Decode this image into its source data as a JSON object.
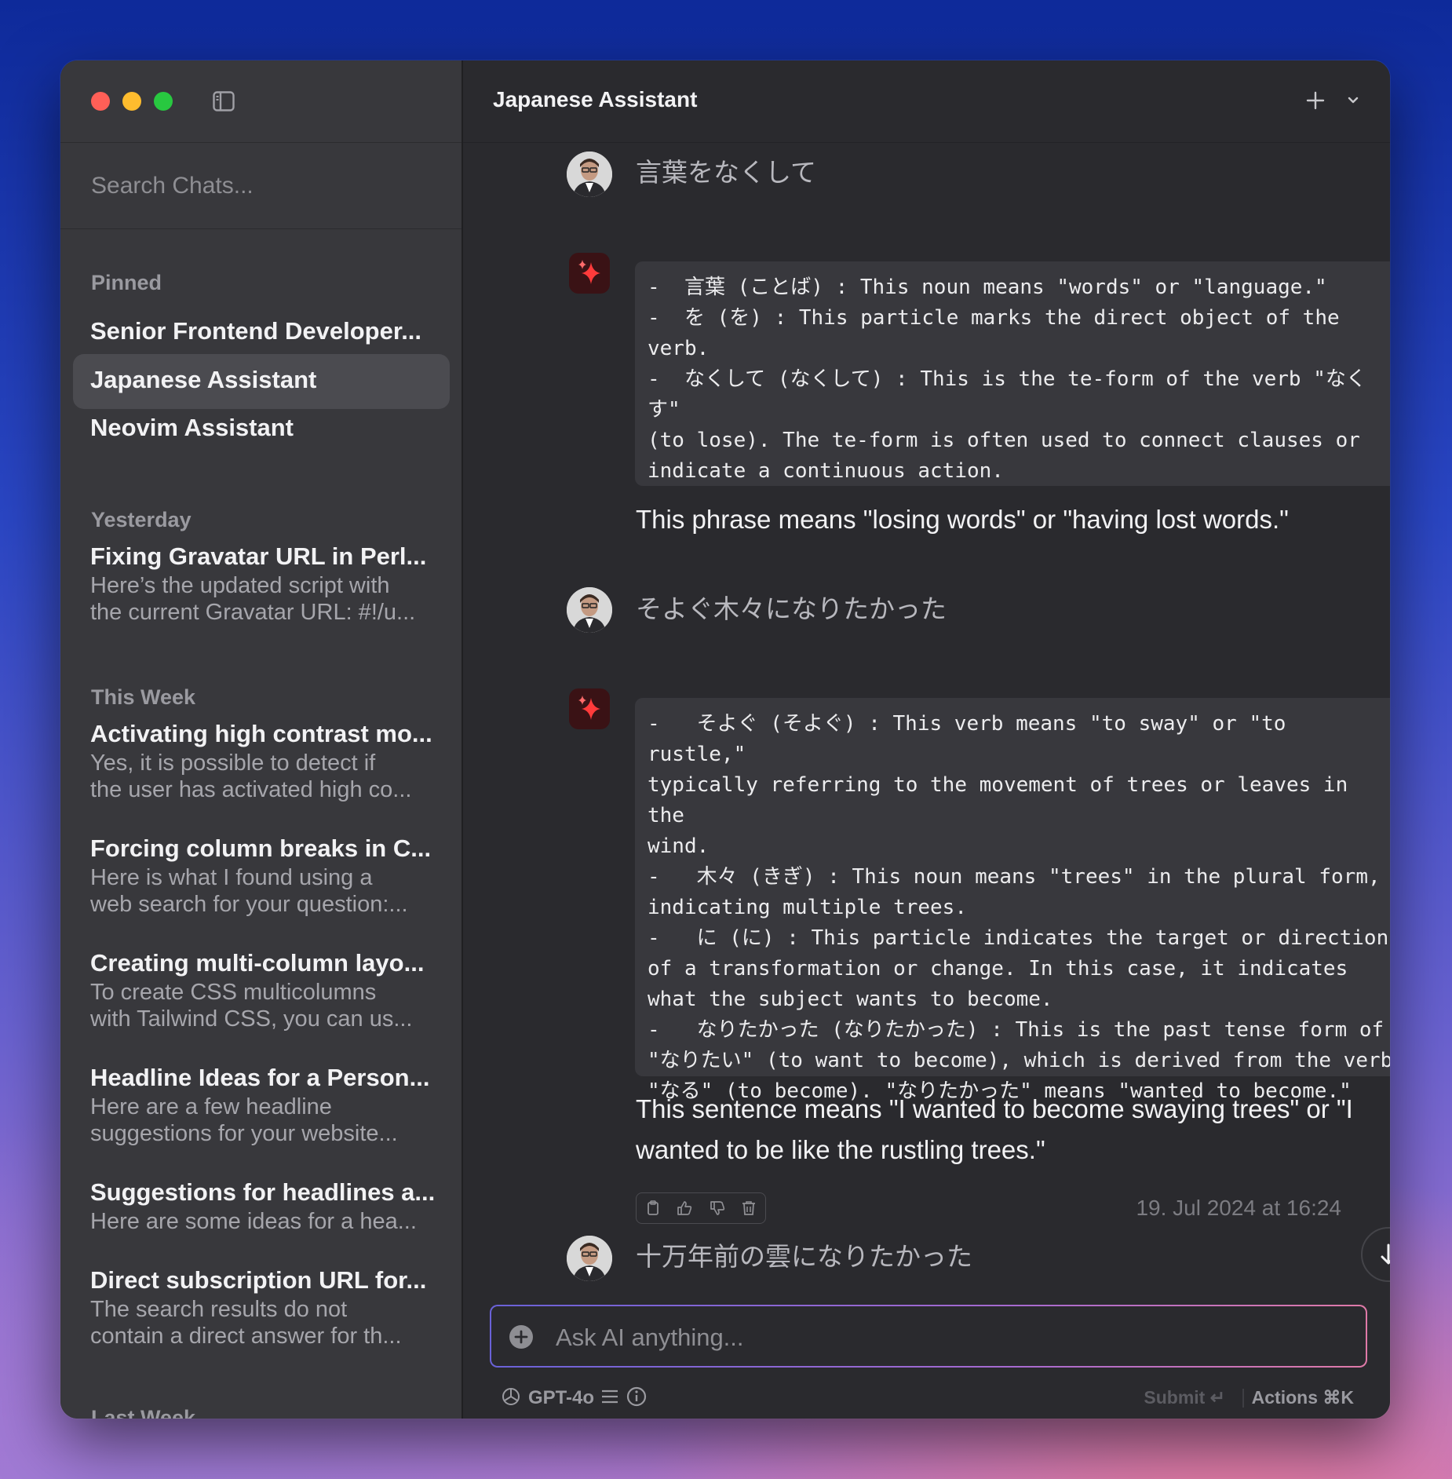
{
  "sidebar": {
    "search_placeholder": "Search Chats...",
    "sections": {
      "pinned": "Pinned",
      "yesterday": "Yesterday",
      "this_week": "This Week",
      "last_week": "Last Week"
    },
    "pinned": [
      {
        "title": "Senior Frontend Developer..."
      },
      {
        "title": "Japanese Assistant",
        "active": true
      },
      {
        "title": "Neovim Assistant"
      }
    ],
    "yesterday": [
      {
        "title": "Fixing Gravatar URL in Perl...",
        "preview": "Here’s the updated script with\nthe current Gravatar URL: #!/u..."
      }
    ],
    "this_week": [
      {
        "title": "Activating high contrast mo...",
        "preview": "Yes, it is possible to detect if\nthe user has activated high co..."
      },
      {
        "title": "Forcing column breaks in C...",
        "preview": "Here is what I found using a\nweb search for your question:..."
      },
      {
        "title": "Creating multi-column layo...",
        "preview": "To create CSS multicolumns\nwith Tailwind CSS, you can us..."
      },
      {
        "title": "Headline Ideas for a Person...",
        "preview": "Here are a few headline\nsuggestions for your website..."
      },
      {
        "title": "Suggestions for headlines a...",
        "preview": "Here are some ideas for a hea..."
      },
      {
        "title": "Direct subscription URL for...",
        "preview": "The search results do not\ncontain a direct answer for th..."
      }
    ]
  },
  "header": {
    "title": "Japanese Assistant"
  },
  "messages": [
    {
      "role": "user",
      "text": "言葉をなくして"
    },
    {
      "role": "assistant",
      "code": "-  言葉 (ことば) : This noun means \"words\" or \"language.\"\n-  を (を) : This particle marks the direct object of the\nverb.\n-  なくして (なくして) : This is the te-form of the verb \"なくす\"\n(to lose). The te-form is often used to connect clauses or\nindicate a continuous action.",
      "text": "This phrase means \"losing words\" or \"having lost words.\""
    },
    {
      "role": "user",
      "text": "そよぐ木々になりたかった"
    },
    {
      "role": "assistant",
      "code": "-   そよぐ (そよぐ) : This verb means \"to sway\" or \"to rustle,\"\ntypically referring to the movement of trees or leaves in the\nwind.\n-   木々 (きぎ) : This noun means \"trees\" in the plural form,\nindicating multiple trees.\n-   に (に) : This particle indicates the target or direction\nof a transformation or change. In this case, it indicates\nwhat the subject wants to become.\n-   なりたかった (なりたかった) : This is the past tense form of\n\"なりたい\" (to want to become), which is derived from the verb\n\"なる\" (to become). \"なりたかった\" means \"wanted to become.\"",
      "text": "This sentence means \"I wanted to become swaying trees\" or \"I wanted to be like the rustling trees.\"",
      "timestamp": "19. Jul 2024 at 16:24"
    },
    {
      "role": "user",
      "text": "十万年前の雲になりたかった"
    }
  ],
  "composer": {
    "placeholder": "Ask AI anything...",
    "model": "GPT-4o",
    "submit_label": "Submit ↵",
    "actions_label": "Actions ⌘K"
  },
  "colors": {
    "accent_gradient": [
      "#6a62d8",
      "#e07aa8"
    ],
    "window_bg": "#2a2a2e",
    "sidebar_bg": "#38383c"
  }
}
